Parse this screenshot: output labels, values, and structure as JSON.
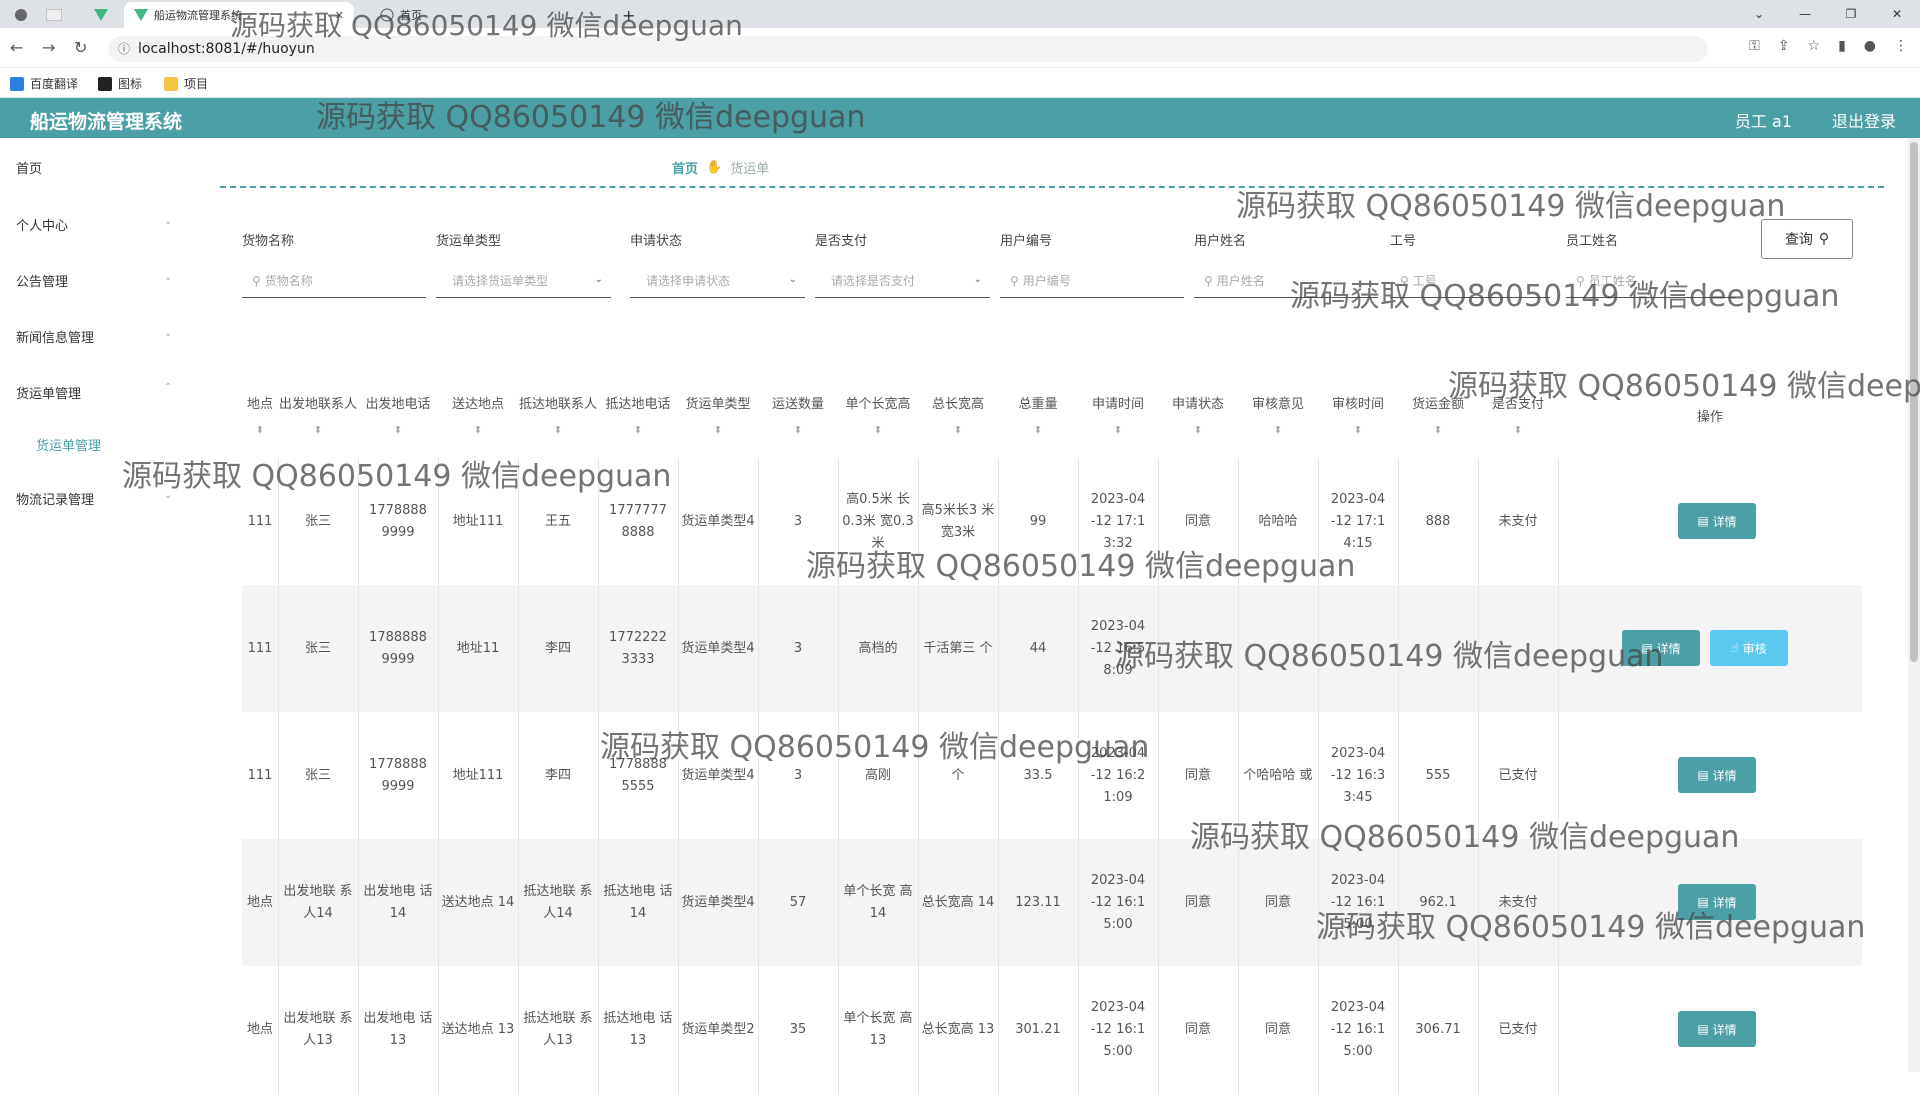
{
  "browser": {
    "tabs": [
      {
        "label": "船运物流管理系统"
      },
      {
        "label": "首页"
      }
    ],
    "url": "localhost:8081/#/huoyun",
    "bookmarks": [
      "百度翻译",
      "图标",
      "项目"
    ]
  },
  "header": {
    "title": "船运物流管理系统",
    "user": "员工 a1",
    "logout": "退出登录"
  },
  "sidebar": {
    "items": [
      {
        "label": "首页"
      },
      {
        "label": "个人中心"
      },
      {
        "label": "公告管理"
      },
      {
        "label": "新闻信息管理"
      },
      {
        "label": "货运单管理"
      },
      {
        "label": "货运单管理"
      },
      {
        "label": "物流记录管理"
      }
    ]
  },
  "breadcrumb": {
    "home": "首页",
    "current": "货运单"
  },
  "filters": [
    {
      "label": "货物名称",
      "placeholder": "货物名称"
    },
    {
      "label": "货运单类型",
      "placeholder": "请选择货运单类型"
    },
    {
      "label": "申请状态",
      "placeholder": "请选择申请状态"
    },
    {
      "label": "是否支付",
      "placeholder": "请选择是否支付"
    },
    {
      "label": "用户编号",
      "placeholder": "用户编号"
    },
    {
      "label": "用户姓名",
      "placeholder": "用户姓名"
    },
    {
      "label": "工号",
      "placeholder": "工号"
    },
    {
      "label": "员工姓名",
      "placeholder": "员工姓名"
    }
  ],
  "search_label": "查询",
  "table": {
    "columns": [
      {
        "label": "地点"
      },
      {
        "label": "出发地联系人"
      },
      {
        "label": "出发地电话"
      },
      {
        "label": "送达地点"
      },
      {
        "label": "抵达地联系人"
      },
      {
        "label": "抵达地电话"
      },
      {
        "label": "货运单类型"
      },
      {
        "label": "运送数量"
      },
      {
        "label": "单个长宽高"
      },
      {
        "label": "总长宽高"
      },
      {
        "label": "总重量"
      },
      {
        "label": "申请时间"
      },
      {
        "label": "申请状态"
      },
      {
        "label": "审核意见"
      },
      {
        "label": "审核时间"
      },
      {
        "label": "货运金额"
      },
      {
        "label": "是否支付"
      },
      {
        "label": "操作"
      }
    ],
    "rows": [
      {
        "c": [
          "111",
          "张三",
          "1778888 9999",
          "地址111",
          "王五",
          "1777777 8888",
          "货运单类型4",
          "3",
          "高0.5米 长0.3米 宽0.3米",
          "高5米长3 米宽3米",
          "99",
          "2023-04 -12 17:1 3:32",
          "同意",
          "哈哈哈",
          "2023-04 -12 17:1 4:15",
          "888",
          "未支付"
        ],
        "actions": [
          "详情"
        ]
      },
      {
        "c": [
          "111",
          "张三",
          "1788888 9999",
          "地址11",
          "李四",
          "1772222 3333",
          "货运单类型4",
          "3",
          "高档的",
          "千活第三 个",
          "44",
          "2023-04 -12 16:5 8:09",
          "",
          "",
          "",
          "",
          ""
        ],
        "actions": [
          "详情",
          "审核"
        ]
      },
      {
        "c": [
          "111",
          "张三",
          "1778888 9999",
          "地址111",
          "李四",
          "1778888 5555",
          "货运单类型4",
          "3",
          "高刚",
          "个",
          "33.5",
          "2023-04 -12 16:2 1:09",
          "同意",
          "个哈哈哈 或",
          "2023-04 -12 16:3 3:45",
          "555",
          "已支付"
        ],
        "actions": [
          "详情"
        ]
      },
      {
        "c": [
          "地点",
          "出发地联 系人14",
          "出发地电 话14",
          "送达地点 14",
          "抵达地联 系人14",
          "抵达地电 话14",
          "货运单类型4",
          "57",
          "单个长宽 高14",
          "总长宽高 14",
          "123.11",
          "2023-04 -12 16:1 5:00",
          "同意",
          "同意",
          "2023-04 -12 16:1 5:00",
          "962.1",
          "未支付"
        ],
        "actions": [
          "详情"
        ]
      },
      {
        "c": [
          "地点",
          "出发地联 系人13",
          "出发地电 话13",
          "送达地点 13",
          "抵达地联 系人13",
          "抵达地电 话13",
          "货运单类型2",
          "35",
          "单个长宽 高13",
          "总长宽高 13",
          "301.21",
          "2023-04 -12 16:1 5:00",
          "同意",
          "同意",
          "2023-04 -12 16:1 5:00",
          "306.71",
          "已支付"
        ],
        "actions": [
          "详情"
        ]
      }
    ]
  },
  "watermark": "源码获取 QQ86050149 微信deepguan"
}
